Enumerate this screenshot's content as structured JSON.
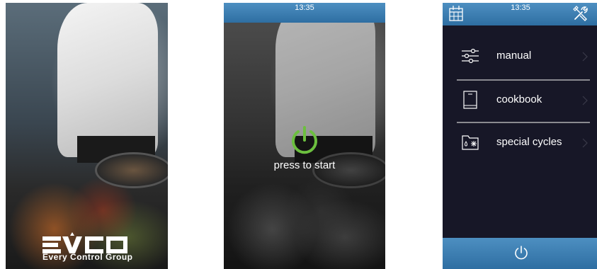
{
  "splash": {
    "brand": "EVCO",
    "tagline": "Every Control Group"
  },
  "start_screen": {
    "time": "13:35",
    "prompt": "press to start",
    "power_icon": "power-icon",
    "accent_color": "#6cbf3f"
  },
  "menu_screen": {
    "time": "13:35",
    "header_left_icon": "calendar-icon",
    "header_right_icon": "tools-icon",
    "items": [
      {
        "label": "manual",
        "icon": "sliders-icon"
      },
      {
        "label": "cookbook",
        "icon": "book-icon"
      },
      {
        "label": "special cycles",
        "icon": "folder-special-icon"
      }
    ],
    "footer_icon": "power-icon",
    "bar_color": "#3a7fb3",
    "background_color": "#171727"
  }
}
